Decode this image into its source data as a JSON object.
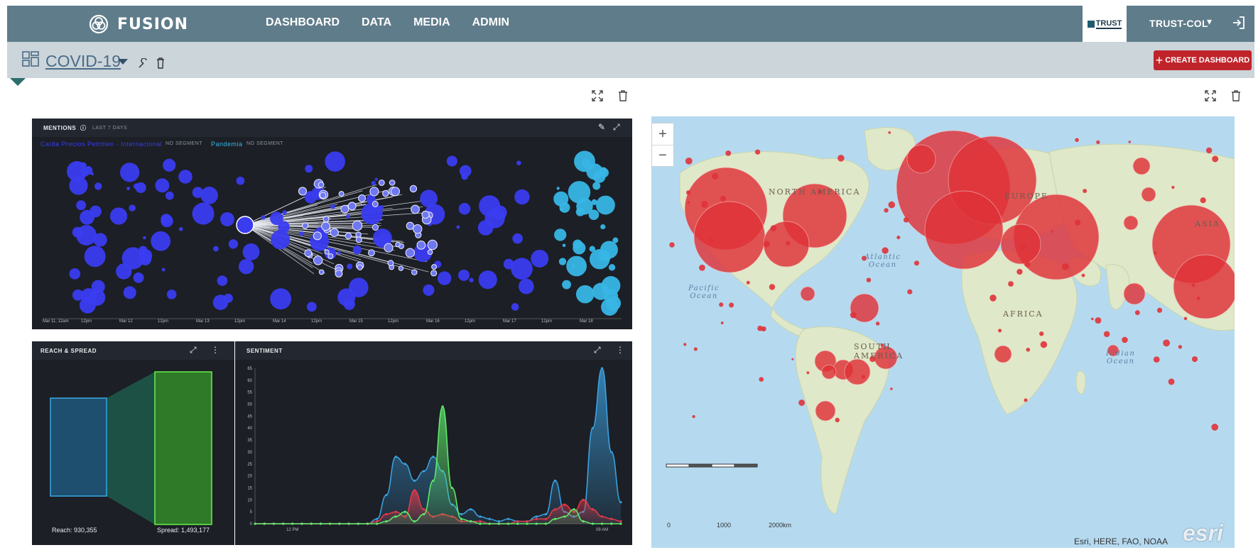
{
  "topbar": {
    "brand": "FUSION",
    "nav": [
      "DASHBOARD",
      "DATA",
      "MEDIA",
      "ADMIN"
    ],
    "org_logo_text": "TRUST",
    "user": "TRUST-COL",
    "user_caret": "▾",
    "logout_icon": "logout-icon"
  },
  "subbar": {
    "dashboard_title": "COVID-19",
    "create_button": "CREATE DASHBOARD",
    "create_plus": "+"
  },
  "mentions": {
    "title": "MENTIONS",
    "range": "LAST 7 DAYS",
    "segment1": "Caída Precios Petróleo - Internacional",
    "segment1_tag": "NO SEGMENT",
    "segment2": "Pandemia",
    "segment2_tag": "NO SEGMENT",
    "ticks": [
      "Mar 11, 12am",
      "12pm",
      "Mar 12",
      "12pm",
      "Mar 13",
      "12pm",
      "Mar 14",
      "12pm",
      "Mar 15",
      "12pm",
      "Mar 16",
      "12pm",
      "Mar 17",
      "12pm",
      "Mar 18"
    ]
  },
  "reach": {
    "title": "REACH & SPREAD",
    "reach_label": "Reach: 930,355",
    "spread_label": "Spread: 1,493,177"
  },
  "sentiment": {
    "title": "SENTIMENT",
    "x_ticks": [
      "12 PM",
      "09 AM"
    ]
  },
  "chart_data": {
    "type": "area",
    "title": "SENTIMENT",
    "ylim": [
      0,
      65
    ],
    "y_ticks": [
      0,
      5,
      10,
      15,
      20,
      25,
      30,
      35,
      40,
      45,
      50,
      55,
      60,
      65
    ],
    "x_points": 40,
    "x_tick_labels": [
      "12 PM",
      "09 AM"
    ],
    "series": [
      {
        "color": "#3aa0e0",
        "values": [
          0,
          0,
          0,
          0,
          0,
          0,
          0,
          0,
          0,
          0,
          0,
          0,
          0,
          2,
          12,
          28,
          25,
          18,
          22,
          28,
          22,
          8,
          4,
          6,
          3,
          2,
          1,
          2,
          1,
          1,
          3,
          4,
          18,
          5,
          3,
          5,
          40,
          65,
          30,
          9
        ]
      },
      {
        "color": "#e03a4a",
        "values": [
          0,
          0,
          0,
          0,
          0,
          0,
          0,
          0,
          0,
          0,
          0,
          0,
          0,
          1,
          4,
          5,
          3,
          14,
          6,
          3,
          4,
          3,
          1,
          1,
          1,
          0,
          0,
          0,
          1,
          1,
          2,
          2,
          6,
          8,
          5,
          10,
          6,
          3,
          2,
          1
        ]
      },
      {
        "color": "#5ee86a",
        "values": [
          0,
          0,
          0,
          0,
          0,
          0,
          0,
          0,
          0,
          0,
          0,
          0,
          0,
          0,
          1,
          3,
          5,
          1,
          4,
          18,
          49,
          15,
          2,
          1,
          0,
          0,
          0,
          0,
          0,
          0,
          0,
          0,
          2,
          3,
          6,
          1,
          0,
          0,
          0,
          0
        ]
      }
    ]
  },
  "map": {
    "zoom_in": "+",
    "zoom_out": "−",
    "labels": {
      "north_america": "NORTH\nAMERICA",
      "south_america": "SOUTH\nAMERICA",
      "africa": "AFRICA",
      "europe": "EUROPE",
      "asia": "ASIA",
      "atlantic": "Atlantic\nOcean",
      "pacific": "Pacific\nOcean",
      "indian": "Indian\nOcean"
    },
    "scale": [
      "0",
      "1000",
      "2000km"
    ],
    "attribution": "Esri, HERE, FAO, NOAA",
    "esri_logo": "esri"
  },
  "colors": {
    "topbar": "#5f7c8a",
    "subbar": "#ccd5da",
    "create_button": "#c0242b",
    "bubble_dark_blue": "#3a3cf0",
    "bubble_light_blue": "#38b6e6",
    "map_bubble": "#e03238"
  }
}
